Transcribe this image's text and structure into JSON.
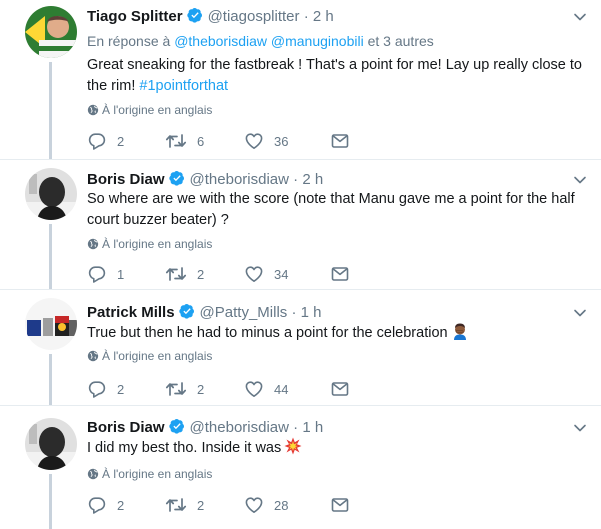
{
  "tweets": [
    {
      "name": "Tiago Splitter",
      "handle": "@tiagosplitter",
      "time": "· 2 h",
      "reply_prefix": "En réponse à",
      "reply_mention_1": "@theborisdiaw",
      "reply_mention_2": "@manuginobili",
      "reply_suffix": "et 3 autres",
      "text": "Great sneaking for the fastbreak ! That's a point for me! Lay up really close to the rim!",
      "hashtag": "#1pointforthat",
      "translate": "À l'origine en anglais",
      "replies": "2",
      "retweets": "6",
      "likes": "36"
    },
    {
      "name": "Boris Diaw",
      "handle": "@theborisdiaw",
      "time": "· 2 h",
      "text": "So where are we with the score (note that Manu gave me a point for the half court buzzer beater) ?",
      "translate": "À l'origine en anglais",
      "replies": "1",
      "retweets": "2",
      "likes": "34"
    },
    {
      "name": "Patrick Mills",
      "handle": "@Patty_Mills",
      "time": "· 1 h",
      "text": "True but then he had to minus a point for the celebration",
      "emoji": "person-facepalming-emoji",
      "translate": "À l'origine en anglais",
      "replies": "2",
      "retweets": "2",
      "likes": "44"
    },
    {
      "name": "Boris Diaw",
      "handle": "@theborisdiaw",
      "time": "· 1 h",
      "text": "I did my best tho. Inside it was",
      "emoji": "collision-emoji",
      "translate": "À l'origine en anglais",
      "replies": "2",
      "retweets": "2",
      "likes": "28"
    }
  ],
  "colors": {
    "accent": "#1da1f2",
    "secondary_text": "#657786",
    "thread_line": "#c8d2dc",
    "separator": "#e6ecf0"
  }
}
